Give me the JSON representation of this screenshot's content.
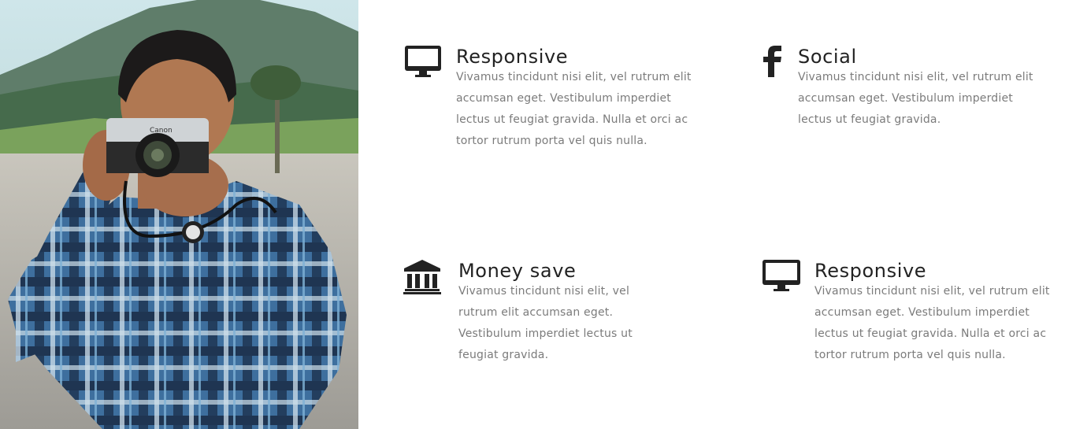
{
  "colors": {
    "heading": "#222222",
    "body_text": "#7b7b7b",
    "icon": "#222222",
    "background": "#ffffff"
  },
  "hero_image": {
    "icon": "photographer-photo",
    "camera_brand": "Canon"
  },
  "features": [
    {
      "icon": "monitor-icon",
      "title": "Responsive",
      "text": "Vivamus tincidunt nisi elit, vel rutrum elit accumsan eget. Vestibulum imperdiet lectus ut feugiat gravida. Nulla et orci ac tortor rutrum porta vel quis nulla."
    },
    {
      "icon": "facebook-icon",
      "title": "Social",
      "text": "Vivamus tincidunt nisi elit, vel rutrum elit accumsan eget. Vestibulum imperdiet lectus ut feugiat gravida."
    },
    {
      "icon": "bank-icon",
      "title": "Money save",
      "text": "Vivamus tincidunt nisi elit, vel rutrum elit accumsan eget. Vestibulum imperdiet lectus ut feugiat gravida."
    },
    {
      "icon": "monitor-icon",
      "title": "Responsive",
      "text": "Vivamus tincidunt nisi elit, vel rutrum elit accumsan eget. Vestibulum imperdiet lectus ut feugiat gravida. Nulla et orci ac tortor rutrum porta vel quis nulla."
    }
  ]
}
